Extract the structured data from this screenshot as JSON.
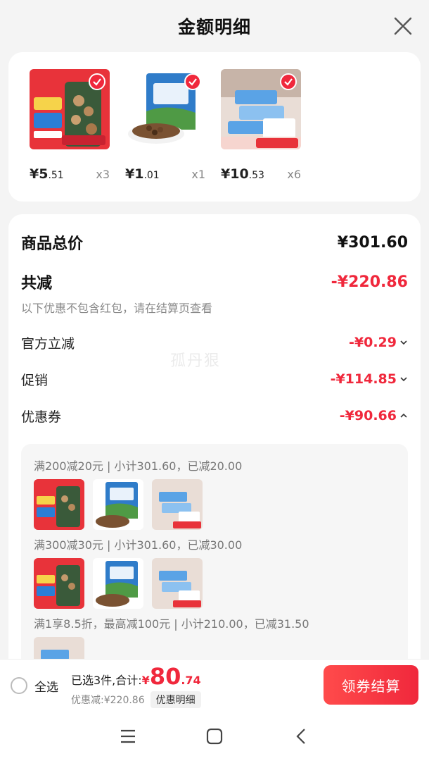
{
  "header": {
    "title": "金额明细"
  },
  "goods": [
    {
      "price_int": "¥5",
      "price_dec": ".51",
      "qty": "x3"
    },
    {
      "price_int": "¥1",
      "price_dec": ".01",
      "qty": "x1"
    },
    {
      "price_int": "¥10",
      "price_dec": ".53",
      "qty": "x6"
    }
  ],
  "summary": {
    "total_label": "商品总价",
    "total_value": "¥301.60",
    "reduce_label": "共减",
    "reduce_value": "-¥220.86",
    "note": "以下优惠不包含红包，请在结算页查看",
    "items": [
      {
        "label": "官方立减",
        "value": "-¥0.29"
      },
      {
        "label": "促销",
        "value": "-¥114.85"
      },
      {
        "label": "优惠券",
        "value": "-¥90.66"
      }
    ]
  },
  "coupons": [
    {
      "text": "满200减20元 | 小计301.60，已减20.00"
    },
    {
      "text": "满300减30元 | 小计301.60，已减30.00"
    },
    {
      "text": "满1享8.5折，最高减100元 | 小计210.00，已减31.50"
    }
  ],
  "watermark": "孤丹狠",
  "bottom": {
    "select_all": "全选",
    "selected_text": "已选3件,合计:",
    "amount_yen": "¥",
    "amount_int": "80",
    "amount_dec": ".74",
    "discount_text": "优惠减:¥220.86",
    "detail_chip": "优惠明细",
    "checkout": "领券结算"
  },
  "colors": {
    "accent": "#f0283c"
  }
}
